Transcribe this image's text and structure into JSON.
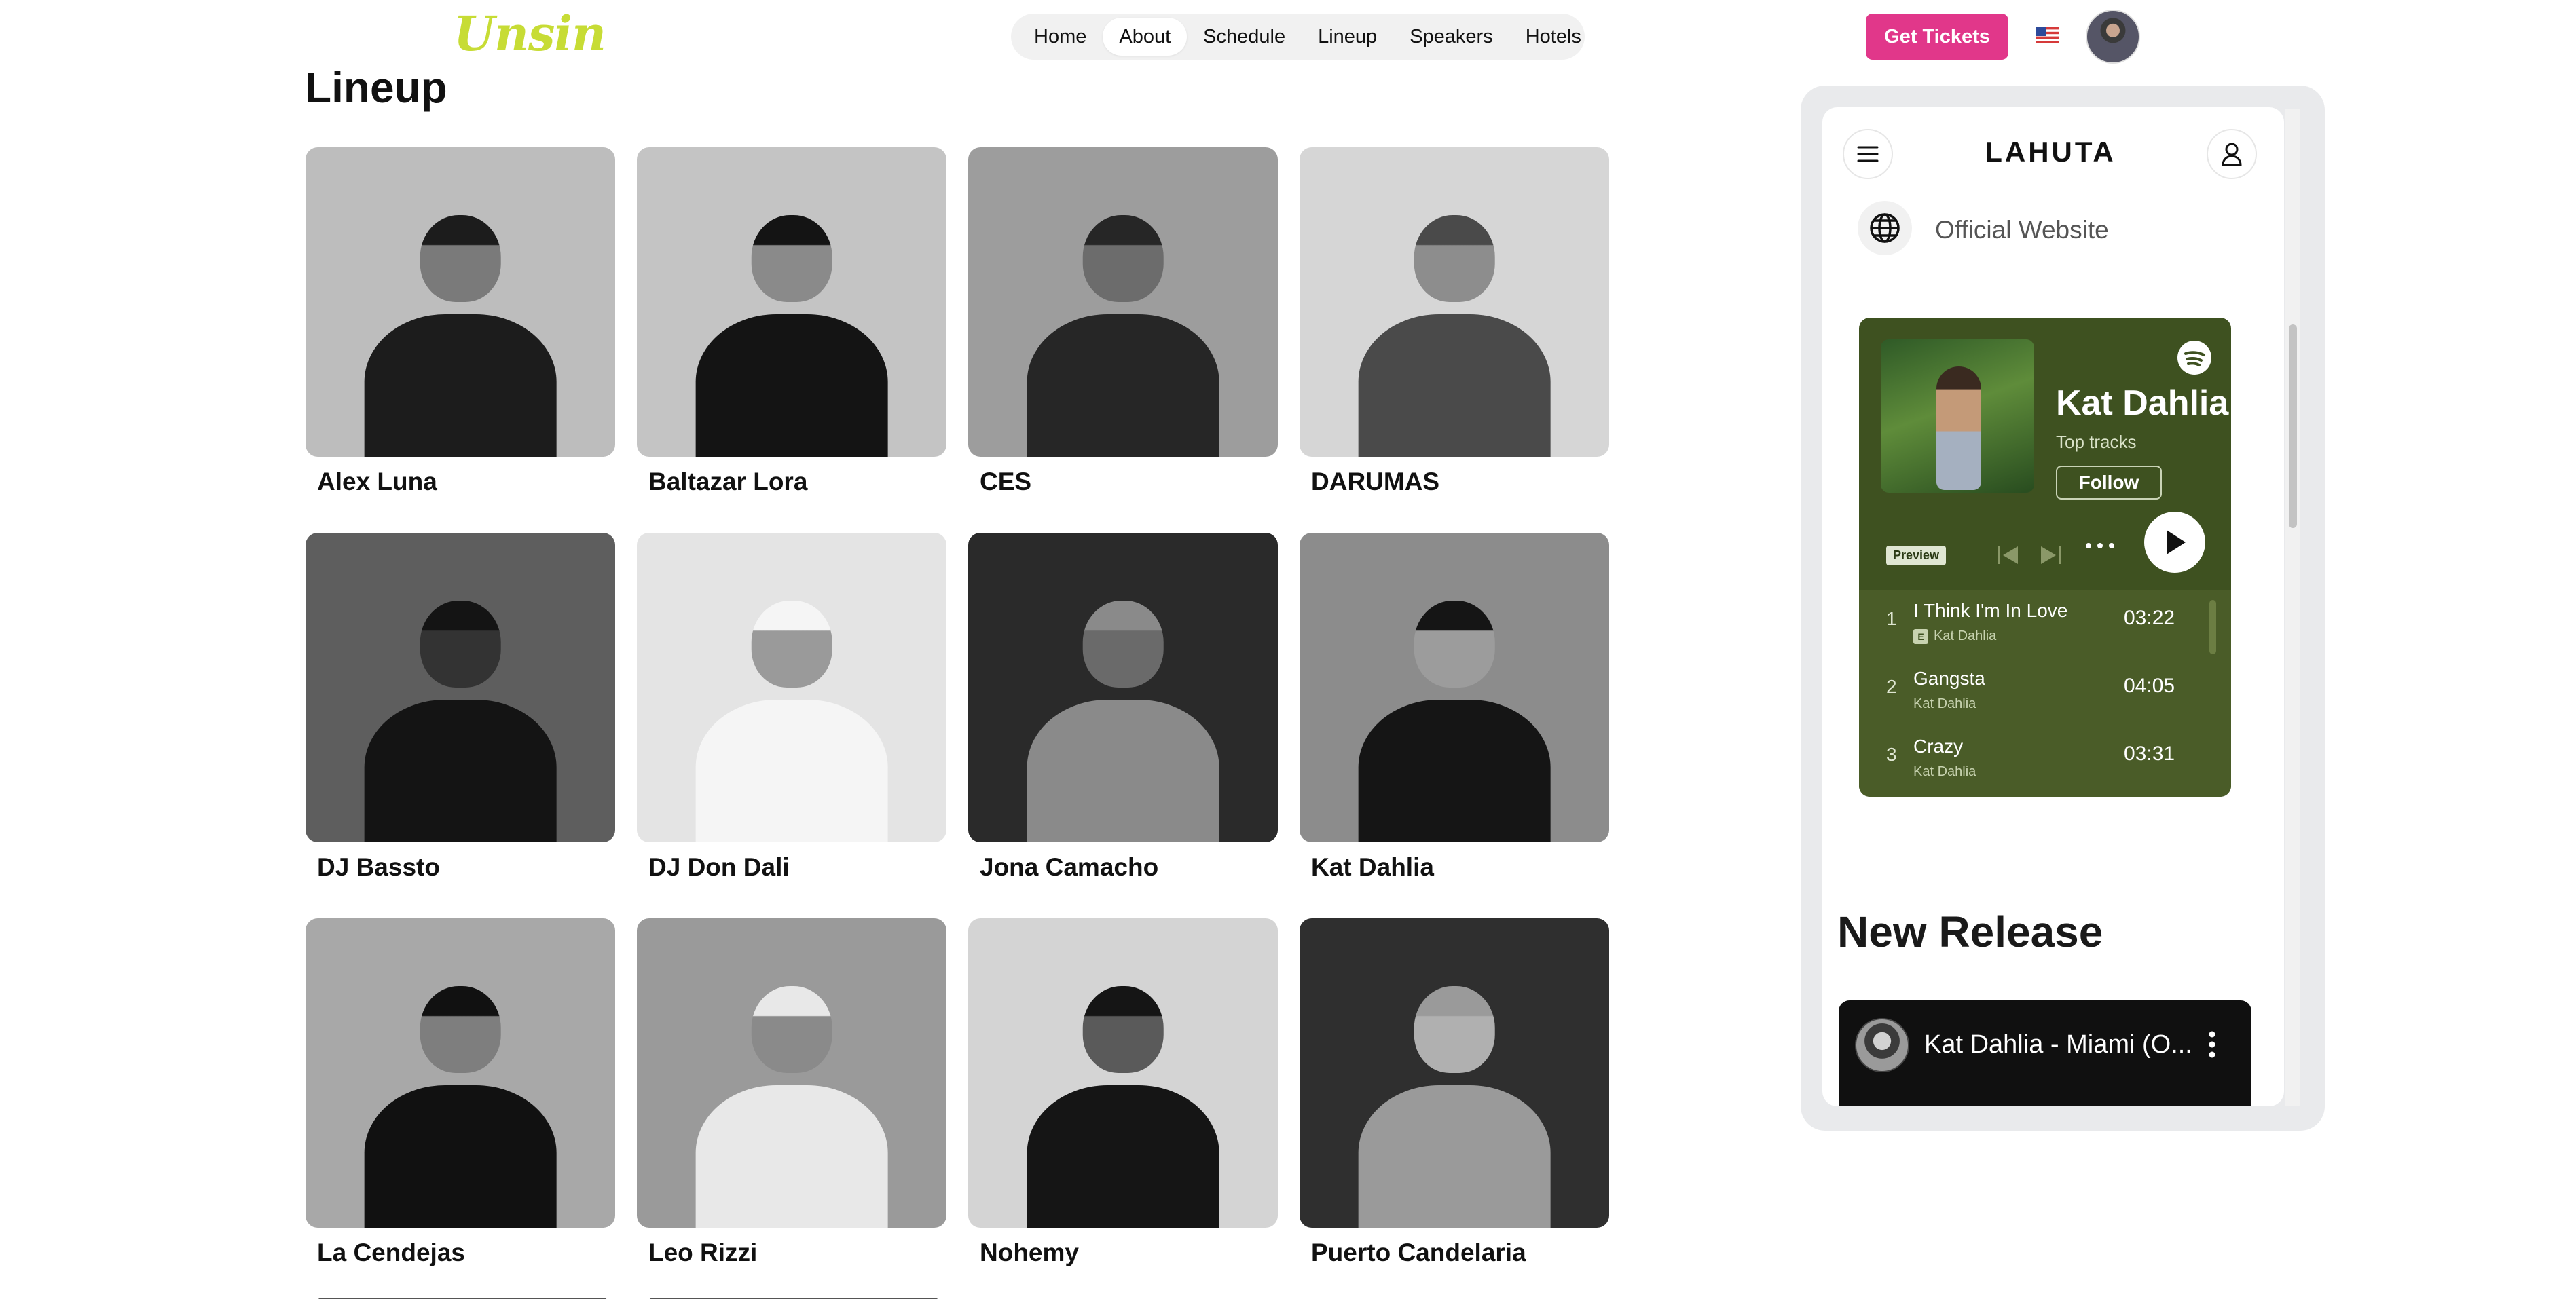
{
  "header": {
    "logo": "Unsin",
    "nav": [
      "Home",
      "About",
      "Schedule",
      "Lineup",
      "Speakers",
      "Hotels"
    ],
    "active_nav": "About",
    "cta_label": "Get Tickets",
    "flag_icon": "us-flag-icon",
    "avatar_icon": "user-avatar"
  },
  "lineup": {
    "title": "Lineup",
    "artists": [
      {
        "name": "Alex Luna",
        "tone": "#bdbdbd",
        "fig": "#1c1c1c",
        "skin": "#7a7a7a"
      },
      {
        "name": "Baltazar Lora",
        "tone": "#c4c4c4",
        "fig": "#141414",
        "skin": "#8a8a8a"
      },
      {
        "name": "CES",
        "tone": "#9d9d9d",
        "fig": "#262626",
        "skin": "#6c6c6c"
      },
      {
        "name": "DARUMAS",
        "tone": "#d6d6d6",
        "fig": "#4a4a4a",
        "skin": "#8d8d8d"
      },
      {
        "name": "DJ Bassto",
        "tone": "#5e5e5e",
        "fig": "#141414",
        "skin": "#333333"
      },
      {
        "name": "DJ Don Dali",
        "tone": "#e4e4e4",
        "fig": "#f5f5f5",
        "skin": "#9a9a9a"
      },
      {
        "name": "Jona Camacho",
        "tone": "#2a2a2a",
        "fig": "#8a8a8a",
        "skin": "#6a6a6a"
      },
      {
        "name": "Kat Dahlia",
        "tone": "#8c8c8c",
        "fig": "#151515",
        "skin": "#9c9c9c"
      },
      {
        "name": "La Cendejas",
        "tone": "#a8a8a8",
        "fig": "#111111",
        "skin": "#7e7e7e"
      },
      {
        "name": "Leo Rizzi",
        "tone": "#9a9a9a",
        "fig": "#e8e8e8",
        "skin": "#8a8a8a"
      },
      {
        "name": "Nohemy",
        "tone": "#d4d4d4",
        "fig": "#151515",
        "skin": "#5a5a5a"
      },
      {
        "name": "Puerto Candelaria",
        "tone": "#2f2f2f",
        "fig": "#9a9a9a",
        "skin": "#b0b0b0"
      }
    ]
  },
  "phone": {
    "brand": "LAHUTA",
    "website_label": "Official Website",
    "spotify": {
      "artist": "Kat Dahlia",
      "subtitle": "Top tracks",
      "follow_label": "Follow",
      "preview_label": "Preview",
      "tracks": [
        {
          "num": "1",
          "title": "I Think I'm In Love",
          "artist": "Kat Dahlia",
          "explicit": "E",
          "duration": "03:22"
        },
        {
          "num": "2",
          "title": "Gangsta",
          "artist": "Kat Dahlia",
          "explicit": "",
          "duration": "04:05"
        },
        {
          "num": "3",
          "title": "Crazy",
          "artist": "Kat Dahlia",
          "explicit": "",
          "duration": "03:31"
        }
      ]
    },
    "new_release_title": "New Release",
    "video_title": "Kat Dahlia - Miami (O..."
  },
  "colors": {
    "logo": "#c7dc35",
    "cta": "#e1378a",
    "spotify_bg": "#3e5120"
  }
}
